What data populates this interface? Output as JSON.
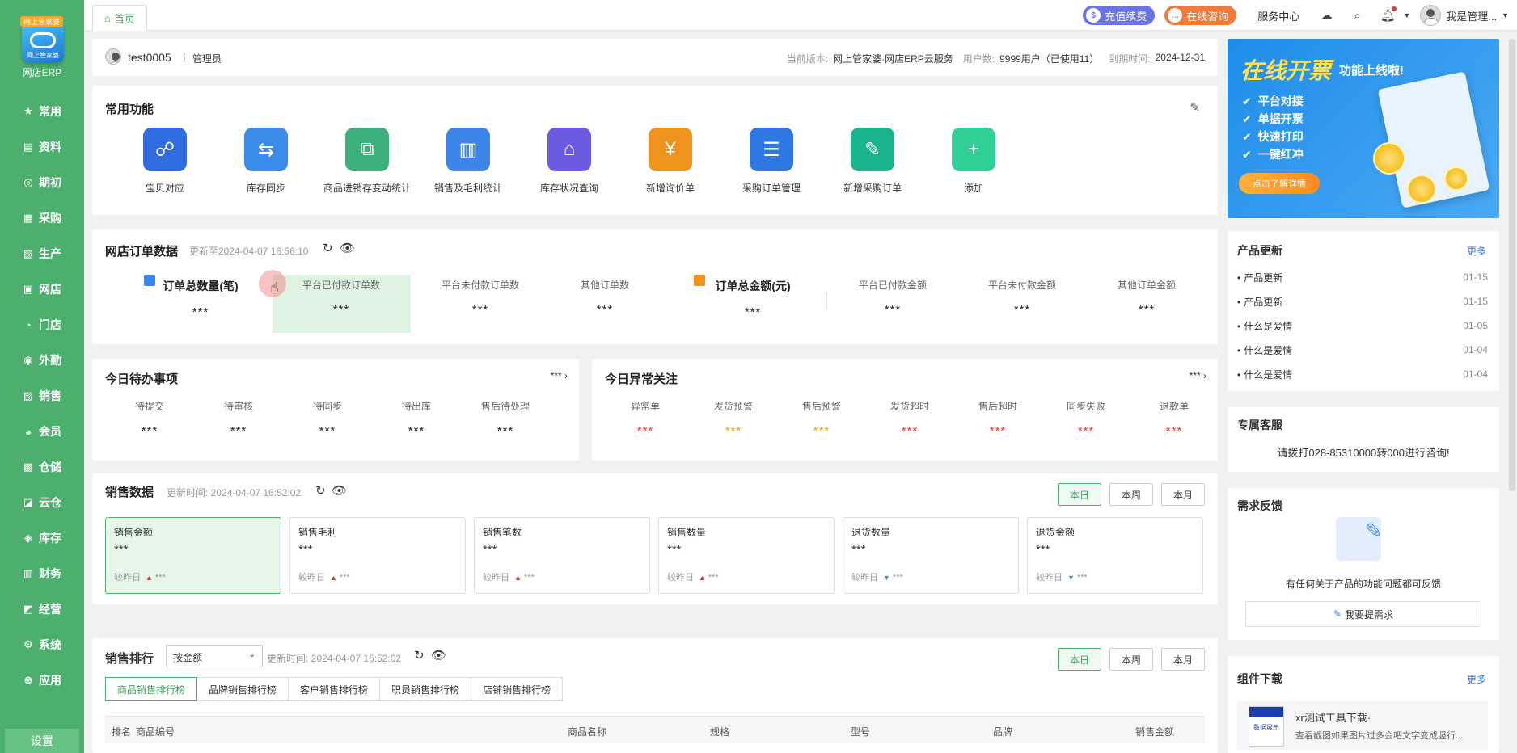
{
  "sidebar": {
    "logo_badge": "网上管家婆",
    "logo_subtitle": "网上管家婆",
    "logo_text": "网店ERP",
    "items": [
      {
        "label": "常用",
        "icon": "star-icon"
      },
      {
        "label": "资料",
        "icon": "document-icon"
      },
      {
        "label": "期初",
        "icon": "target-icon"
      },
      {
        "label": "采购",
        "icon": "cart-icon"
      },
      {
        "label": "生产",
        "icon": "factory-icon"
      },
      {
        "label": "网店",
        "icon": "shop-icon"
      },
      {
        "label": "门店",
        "icon": "store-icon"
      },
      {
        "label": "外勤",
        "icon": "location-icon"
      },
      {
        "label": "销售",
        "icon": "sales-icon"
      },
      {
        "label": "会员",
        "icon": "member-icon"
      },
      {
        "label": "仓储",
        "icon": "warehouse-icon"
      },
      {
        "label": "云仓",
        "icon": "cloud-warehouse-icon"
      },
      {
        "label": "库存",
        "icon": "stock-icon"
      },
      {
        "label": "财务",
        "icon": "finance-icon"
      },
      {
        "label": "经营",
        "icon": "business-icon"
      },
      {
        "label": "系统",
        "icon": "system-icon"
      },
      {
        "label": "应用",
        "icon": "app-icon"
      }
    ],
    "settings": "设置"
  },
  "topbar": {
    "tab_home": "首页",
    "recharge": "充值续费",
    "consult": "在线咨询",
    "service": "服务中心",
    "user_name": "我是管理..."
  },
  "header": {
    "account": "test0005",
    "role": "管理员",
    "version_label": "当前版本:",
    "version_value": "网上管家婆·网店ERP云服务",
    "users_label": "用户数:",
    "users_value": "9999用户（已使用11）",
    "expiry_label": "到期时间:",
    "expiry_value": "2024-12-31"
  },
  "common": {
    "title": "常用功能",
    "items": [
      {
        "label": "宝贝对应",
        "color": "#2f6de1",
        "icon": "☍"
      },
      {
        "label": "库存同步",
        "color": "#3b8be8",
        "icon": "⇆"
      },
      {
        "label": "商品进销存变动统计",
        "color": "#3bb07a",
        "icon": "⧉"
      },
      {
        "label": "销售及毛利统计",
        "color": "#3b86e8",
        "icon": "▥"
      },
      {
        "label": "库存状况查询",
        "color": "#6a5be0",
        "icon": "⌂"
      },
      {
        "label": "新增询价单",
        "color": "#f0931e",
        "icon": "¥"
      },
      {
        "label": "采购订单管理",
        "color": "#2f78e1",
        "icon": "☰"
      },
      {
        "label": "新增采购订单",
        "color": "#19b48c",
        "icon": "✎"
      },
      {
        "label": "添加",
        "color": "#2fcf95",
        "icon": "+"
      }
    ]
  },
  "orders": {
    "title": "网店订单数据",
    "updated": "更新至2024-04-07 16:56:10",
    "count_title": "订单总数量(笔)",
    "count_value": "***",
    "amount_title": "订单总金额(元)",
    "amount_value": "***",
    "count_items": [
      {
        "label": "平台已付款订单数",
        "value": "***"
      },
      {
        "label": "平台未付款订单数",
        "value": "***"
      },
      {
        "label": "其他订单数",
        "value": "***"
      }
    ],
    "amount_items": [
      {
        "label": "平台已付款金额",
        "value": "***"
      },
      {
        "label": "平台未付款金额",
        "value": "***"
      },
      {
        "label": "其他订单金额",
        "value": "***"
      }
    ]
  },
  "todo": {
    "title": "今日待办事项",
    "more": "***",
    "items": [
      {
        "label": "待提交",
        "value": "***"
      },
      {
        "label": "待审核",
        "value": "***"
      },
      {
        "label": "待同步",
        "value": "***"
      },
      {
        "label": "待出库",
        "value": "***"
      },
      {
        "label": "售后待处理",
        "value": "***"
      }
    ]
  },
  "abnormal": {
    "title": "今日异常关注",
    "more": "***",
    "items": [
      {
        "label": "异常单",
        "value": "***",
        "color": "#e53935"
      },
      {
        "label": "发货预警",
        "value": "***",
        "color": "#f0a020"
      },
      {
        "label": "售后预警",
        "value": "***",
        "color": "#f0a020"
      },
      {
        "label": "发货超时",
        "value": "***",
        "color": "#e53935"
      },
      {
        "label": "售后超时",
        "value": "***",
        "color": "#e53935"
      },
      {
        "label": "同步失败",
        "value": "***",
        "color": "#e53935"
      },
      {
        "label": "退款单",
        "value": "***",
        "color": "#e53935"
      }
    ]
  },
  "sales": {
    "title": "销售数据",
    "updated": "更新时间: 2024-04-07 16:52:02",
    "periods": [
      "本日",
      "本周",
      "本月"
    ],
    "compare_label": "较昨日",
    "kpis": [
      {
        "label": "销售金额",
        "value": "***",
        "trend": "up",
        "delta": "***"
      },
      {
        "label": "销售毛利",
        "value": "***",
        "trend": "up",
        "delta": "***"
      },
      {
        "label": "销售笔数",
        "value": "***",
        "trend": "up",
        "delta": "***"
      },
      {
        "label": "销售数量",
        "value": "***",
        "trend": "up",
        "delta": "***"
      },
      {
        "label": "退货数量",
        "value": "***",
        "trend": "down",
        "delta": "***"
      },
      {
        "label": "退货金额",
        "value": "***",
        "trend": "down",
        "delta": "***"
      }
    ]
  },
  "ranking": {
    "title": "销售排行",
    "select_value": "按金额",
    "updated": "更新时间: 2024-04-07 16:52:02",
    "periods": [
      "本日",
      "本周",
      "本月"
    ],
    "tabs": [
      "商品销售排行榜",
      "品牌销售排行榜",
      "客户销售排行榜",
      "职员销售排行榜",
      "店铺销售排行榜"
    ],
    "columns": [
      "排名",
      "商品编号",
      "商品名称",
      "规格",
      "型号",
      "品牌",
      "销售金额"
    ]
  },
  "banner": {
    "title": "在线开票",
    "subtitle": "功能上线啦!",
    "points": [
      "平台对接",
      "单据开票",
      "快速打印",
      "一键红冲"
    ],
    "cta": "点击了解详情"
  },
  "updates": {
    "title": "产品更新",
    "more": "更多",
    "items": [
      {
        "label": "产品更新",
        "date": "01-15"
      },
      {
        "label": "产品更新",
        "date": "01-15"
      },
      {
        "label": "什么是爱情",
        "date": "01-05"
      },
      {
        "label": "什么是爱情",
        "date": "01-04"
      },
      {
        "label": "什么是爱情",
        "date": "01-04"
      }
    ]
  },
  "support": {
    "title": "专属客服",
    "text": "请拨打028-85310000转000进行咨询!"
  },
  "feedback": {
    "title": "需求反馈",
    "text": "有任何关于产品的功能问题都可反馈",
    "button": "我要提需求"
  },
  "downloads": {
    "title": "组件下载",
    "more": "更多",
    "item_title": "xr测试工具下载·",
    "item_desc": "查看截图如果图片过多会吧文字变成竖行...",
    "item_thumb": "数据展示"
  }
}
